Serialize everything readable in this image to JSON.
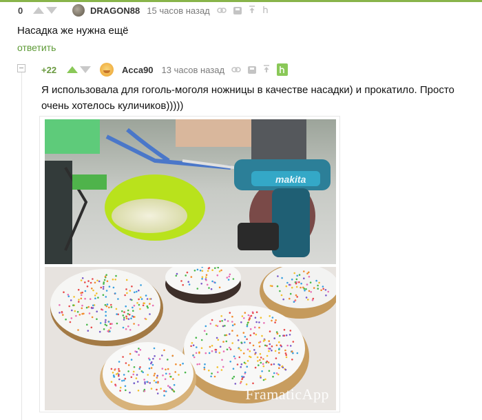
{
  "comment1": {
    "rating": "0",
    "author": "DRAGON88",
    "time": "15 часов назад",
    "text": "Насадка же нужна ещё",
    "reply_label": "ответить"
  },
  "comment2": {
    "rating": "+22",
    "author": "Acca90",
    "time": "13 часов назад",
    "text": "Я использовала для гоголь-моголя ножницы в качестве насадки) и прокатило. Просто очень хотелось куличиков)))))",
    "image": {
      "watermark": "FramaticApp",
      "top_description_icon": "photo-mixer-bowl",
      "bottom_description_icon": "photo-kulich-cakes"
    }
  },
  "icons": {
    "link": "link-icon",
    "save": "save-icon",
    "up": "arrow-up-icon",
    "hide": "hide-icon",
    "pin": "pin-icon"
  },
  "colors": {
    "accent_green": "#8ac858",
    "reply_green": "#5d9a36",
    "rating_green": "#6a9a40",
    "icon_gray": "#c4c4c4",
    "top_line": "#88b44a"
  }
}
